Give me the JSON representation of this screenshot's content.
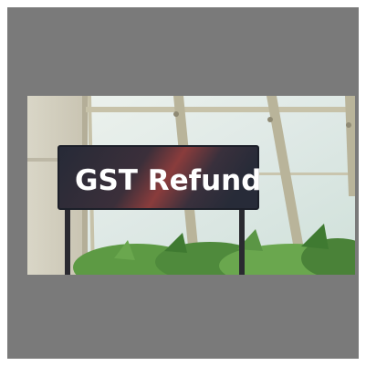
{
  "image": {
    "subject": "photo-with-sign",
    "sign": {
      "text": "GST Refund"
    },
    "colors": {
      "outer_frame": "#7a7a7a",
      "sign_dark": "#2b2f3d",
      "sign_accent": "#8a3c3c",
      "glass": "#e7eee8",
      "mullion": "#b9b49a",
      "plant": "#4f8a3c"
    }
  }
}
